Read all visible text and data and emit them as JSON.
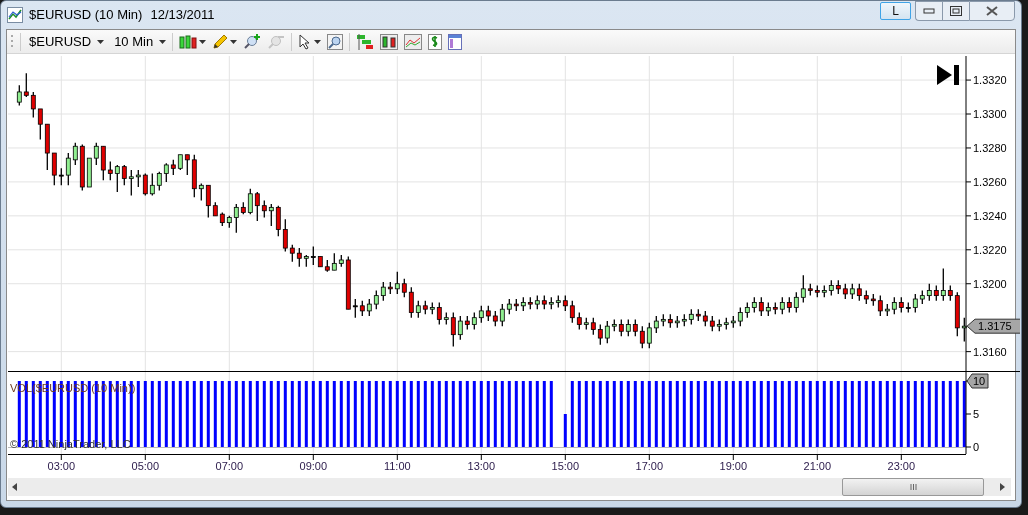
{
  "window": {
    "title": "$EURUSD (10 Min)",
    "date": "12/13/2011",
    "buttons": [
      {
        "label": "L"
      }
    ]
  },
  "toolbar": {
    "instrument": "$EURUSD",
    "interval": "10 Min"
  },
  "price_panel": {
    "last_price": "1.3175",
    "chart_data": {
      "type": "candlestick",
      "grid": true,
      "categories": [
        null,
        null,
        null,
        null,
        null,
        null,
        null,
        null,
        null,
        null,
        null,
        null,
        null,
        null,
        null,
        null,
        null,
        null,
        null,
        null,
        null,
        null,
        null,
        null,
        null,
        null,
        null,
        null,
        null,
        null,
        null,
        null,
        null,
        null,
        null,
        null,
        null,
        null,
        null,
        null,
        null,
        null,
        null,
        null,
        null,
        null,
        null,
        null,
        null,
        null,
        null,
        null,
        null,
        null,
        null,
        null,
        null,
        null,
        null,
        null,
        null,
        null,
        null,
        null,
        null,
        null,
        null,
        null,
        null,
        null,
        null,
        null,
        null,
        null,
        null,
        null,
        null,
        null,
        null,
        null,
        null,
        null,
        null,
        null,
        null,
        null,
        null,
        null,
        null,
        null,
        null,
        null,
        null,
        null,
        null,
        null,
        null,
        null,
        null,
        null,
        null,
        null,
        null,
        null,
        null,
        null,
        null,
        null,
        null,
        null,
        null,
        null,
        null,
        null,
        null,
        null,
        null,
        null,
        null,
        null,
        null,
        null,
        null,
        null,
        null,
        null,
        null,
        null,
        null,
        null,
        null,
        null,
        null,
        null,
        null,
        null
      ],
      "ylim": [
        1.3148,
        1.3333
      ],
      "yticks": [
        {
          "value": 1.316,
          "label": "1.3160"
        },
        {
          "value": 1.32,
          "label": "1.3200"
        },
        {
          "value": 1.322,
          "label": "1.3220"
        },
        {
          "value": 1.324,
          "label": "1.3240"
        },
        {
          "value": 1.326,
          "label": "1.3260"
        },
        {
          "value": 1.328,
          "label": "1.3280"
        },
        {
          "value": 1.33,
          "label": "1.3300"
        },
        {
          "value": 1.332,
          "label": "1.3320"
        }
      ],
      "ohlc": [
        [
          1.3307,
          1.3317,
          1.3305,
          1.3313
        ],
        [
          1.3313,
          1.3324,
          1.331,
          1.3311
        ],
        [
          1.3311,
          1.3313,
          1.3298,
          1.3303
        ],
        [
          1.3303,
          1.3303,
          1.3285,
          1.3294
        ],
        [
          1.3294,
          1.3294,
          1.3267,
          1.3277
        ],
        [
          1.3277,
          1.3277,
          1.3258,
          1.3264
        ],
        [
          1.3264,
          1.3268,
          1.3258,
          1.3264
        ],
        [
          1.3264,
          1.3277,
          1.3258,
          1.3274
        ],
        [
          1.3273,
          1.3283,
          1.327,
          1.3281
        ],
        [
          1.3281,
          1.3282,
          1.3255,
          1.3257
        ],
        [
          1.3257,
          1.3274,
          1.3257,
          1.3274
        ],
        [
          1.3274,
          1.3283,
          1.327,
          1.3281
        ],
        [
          1.3281,
          1.3281,
          1.3261,
          1.3267
        ],
        [
          1.3267,
          1.3272,
          1.3261,
          1.3265
        ],
        [
          1.3265,
          1.327,
          1.3254,
          1.3269
        ],
        [
          1.3269,
          1.327,
          1.3258,
          1.3262
        ],
        [
          1.3262,
          1.3267,
          1.3252,
          1.3263
        ],
        [
          1.3263,
          1.3267,
          1.3257,
          1.3264
        ],
        [
          1.3264,
          1.3265,
          1.3252,
          1.3253
        ],
        [
          1.3253,
          1.3265,
          1.3252,
          1.3258
        ],
        [
          1.3258,
          1.3266,
          1.3255,
          1.3265
        ],
        [
          1.3265,
          1.3271,
          1.326,
          1.327
        ],
        [
          1.327,
          1.3273,
          1.3264,
          1.3268
        ],
        [
          1.3268,
          1.3276,
          1.3267,
          1.3276
        ],
        [
          1.3276,
          1.3276,
          1.3264,
          1.3273
        ],
        [
          1.3273,
          1.3276,
          1.3251,
          1.3256
        ],
        [
          1.3256,
          1.3259,
          1.3249,
          1.3258
        ],
        [
          1.3258,
          1.3258,
          1.3239,
          1.3246
        ],
        [
          1.3246,
          1.3248,
          1.324,
          1.324
        ],
        [
          1.3241,
          1.3242,
          1.3234,
          1.3236
        ],
        [
          1.3236,
          1.324,
          1.3233,
          1.3239
        ],
        [
          1.3239,
          1.3247,
          1.323,
          1.3245
        ],
        [
          1.3245,
          1.3248,
          1.3241,
          1.3242
        ],
        [
          1.3242,
          1.3256,
          1.3241,
          1.3253
        ],
        [
          1.3253,
          1.3254,
          1.3237,
          1.3246
        ],
        [
          1.3246,
          1.3249,
          1.3239,
          1.3243
        ],
        [
          1.3243,
          1.3247,
          1.3234,
          1.3245
        ],
        [
          1.3245,
          1.3246,
          1.3228,
          1.3232
        ],
        [
          1.3232,
          1.3238,
          1.3219,
          1.3221
        ],
        [
          1.3221,
          1.3223,
          1.3213,
          1.3218
        ],
        [
          1.3218,
          1.3221,
          1.321,
          1.3215
        ],
        [
          1.3215,
          1.3217,
          1.321,
          1.3216
        ],
        [
          1.3216,
          1.3222,
          1.3211,
          1.3216
        ],
        [
          1.3216,
          1.3216,
          1.321,
          1.321
        ],
        [
          1.321,
          1.3214,
          1.3207,
          1.3208
        ],
        [
          1.3208,
          1.3218,
          1.3208,
          1.3212
        ],
        [
          1.3212,
          1.3217,
          1.321,
          1.3214
        ],
        [
          1.3214,
          1.3216,
          1.3185,
          1.3185
        ],
        [
          1.3187,
          1.3191,
          1.318,
          1.3187
        ],
        [
          1.3187,
          1.319,
          1.3181,
          1.3184
        ],
        [
          1.3184,
          1.3191,
          1.3181,
          1.3188
        ],
        [
          1.3188,
          1.3196,
          1.3185,
          1.3193
        ],
        [
          1.3193,
          1.3201,
          1.319,
          1.3198
        ],
        [
          1.3198,
          1.3201,
          1.3194,
          1.3197
        ],
        [
          1.3197,
          1.3207,
          1.3194,
          1.32
        ],
        [
          1.32,
          1.3203,
          1.3192,
          1.3195
        ],
        [
          1.3195,
          1.3198,
          1.318,
          1.3183
        ],
        [
          1.3183,
          1.319,
          1.318,
          1.3187
        ],
        [
          1.3187,
          1.319,
          1.3182,
          1.3185
        ],
        [
          1.3185,
          1.3189,
          1.3182,
          1.3186
        ],
        [
          1.3186,
          1.3189,
          1.3176,
          1.3179
        ],
        [
          1.3179,
          1.3183,
          1.3176,
          1.318
        ],
        [
          1.318,
          1.3183,
          1.3163,
          1.317
        ],
        [
          1.317,
          1.3181,
          1.3167,
          1.3178
        ],
        [
          1.3178,
          1.3181,
          1.3173,
          1.3176
        ],
        [
          1.3176,
          1.3183,
          1.3173,
          1.318
        ],
        [
          1.318,
          1.3187,
          1.3177,
          1.3184
        ],
        [
          1.3184,
          1.3187,
          1.3178,
          1.3181
        ],
        [
          1.3181,
          1.3184,
          1.3175,
          1.3178
        ],
        [
          1.3178,
          1.3188,
          1.3175,
          1.3185
        ],
        [
          1.3185,
          1.3191,
          1.3182,
          1.3188
        ],
        [
          1.3188,
          1.3191,
          1.3184,
          1.3187
        ],
        [
          1.3187,
          1.3192,
          1.3184,
          1.3189
        ],
        [
          1.3189,
          1.3192,
          1.3185,
          1.3188
        ],
        [
          1.3188,
          1.3193,
          1.3185,
          1.319
        ],
        [
          1.319,
          1.3193,
          1.3185,
          1.3188
        ],
        [
          1.3188,
          1.3192,
          1.3185,
          1.3189
        ],
        [
          1.3189,
          1.3193,
          1.3186,
          1.319
        ],
        [
          1.319,
          1.3193,
          1.3184,
          1.3187
        ],
        [
          1.3187,
          1.319,
          1.3177,
          1.318
        ],
        [
          1.318,
          1.3183,
          1.3173,
          1.3176
        ],
        [
          1.3176,
          1.318,
          1.3173,
          1.3177
        ],
        [
          1.3177,
          1.318,
          1.317,
          1.3173
        ],
        [
          1.3173,
          1.3176,
          1.3164,
          1.3168
        ],
        [
          1.3168,
          1.3178,
          1.3165,
          1.3175
        ],
        [
          1.3175,
          1.3179,
          1.3172,
          1.3176
        ],
        [
          1.3176,
          1.3179,
          1.3169,
          1.3172
        ],
        [
          1.3172,
          1.3179,
          1.3169,
          1.3176
        ],
        [
          1.3176,
          1.3179,
          1.3169,
          1.3172
        ],
        [
          1.3172,
          1.3175,
          1.3162,
          1.3165
        ],
        [
          1.3165,
          1.3177,
          1.3162,
          1.3174
        ],
        [
          1.3174,
          1.3181,
          1.3171,
          1.3178
        ],
        [
          1.3178,
          1.3182,
          1.3175,
          1.3179
        ],
        [
          1.3179,
          1.3182,
          1.3174,
          1.3177
        ],
        [
          1.3177,
          1.3181,
          1.3174,
          1.3178
        ],
        [
          1.3178,
          1.3182,
          1.3175,
          1.3179
        ],
        [
          1.3179,
          1.3185,
          1.3176,
          1.3182
        ],
        [
          1.3182,
          1.3185,
          1.3178,
          1.3181
        ],
        [
          1.3181,
          1.3184,
          1.3175,
          1.3178
        ],
        [
          1.3178,
          1.3181,
          1.3172,
          1.3175
        ],
        [
          1.3175,
          1.3179,
          1.3172,
          1.3176
        ],
        [
          1.3176,
          1.318,
          1.3173,
          1.3177
        ],
        [
          1.3177,
          1.3181,
          1.3174,
          1.3178
        ],
        [
          1.3178,
          1.3186,
          1.3175,
          1.3183
        ],
        [
          1.3183,
          1.3189,
          1.318,
          1.3186
        ],
        [
          1.3186,
          1.3192,
          1.3183,
          1.3189
        ],
        [
          1.3189,
          1.3192,
          1.3181,
          1.3184
        ],
        [
          1.3184,
          1.3189,
          1.3181,
          1.3186
        ],
        [
          1.3186,
          1.3189,
          1.3182,
          1.3185
        ],
        [
          1.3185,
          1.3192,
          1.3182,
          1.3189
        ],
        [
          1.3189,
          1.3192,
          1.3183,
          1.3186
        ],
        [
          1.3186,
          1.3195,
          1.3183,
          1.3192
        ],
        [
          1.3192,
          1.3205,
          1.3189,
          1.3197
        ],
        [
          1.3197,
          1.32,
          1.3193,
          1.3196
        ],
        [
          1.3196,
          1.3199,
          1.3192,
          1.3195
        ],
        [
          1.3195,
          1.3199,
          1.3192,
          1.3196
        ],
        [
          1.3196,
          1.3202,
          1.3193,
          1.3199
        ],
        [
          1.3199,
          1.3202,
          1.3194,
          1.3197
        ],
        [
          1.3197,
          1.32,
          1.3191,
          1.3194
        ],
        [
          1.3194,
          1.32,
          1.3191,
          1.3197
        ],
        [
          1.3197,
          1.32,
          1.319,
          1.3193
        ],
        [
          1.3193,
          1.3196,
          1.3188,
          1.3191
        ],
        [
          1.3191,
          1.3194,
          1.3187,
          1.319
        ],
        [
          1.319,
          1.3193,
          1.3181,
          1.3184
        ],
        [
          1.3184,
          1.3188,
          1.3181,
          1.3185
        ],
        [
          1.3185,
          1.3192,
          1.3182,
          1.3189
        ],
        [
          1.3189,
          1.3192,
          1.3183,
          1.3186
        ],
        [
          1.3186,
          1.3189,
          1.3183,
          1.3186
        ],
        [
          1.3186,
          1.3194,
          1.3183,
          1.3191
        ],
        [
          1.3191,
          1.3196,
          1.3188,
          1.3193
        ],
        [
          1.3193,
          1.32,
          1.319,
          1.3196
        ],
        [
          1.3196,
          1.3199,
          1.319,
          1.3193
        ],
        [
          1.3193,
          1.3209,
          1.319,
          1.3196
        ],
        [
          1.3196,
          1.3199,
          1.319,
          1.3193
        ],
        [
          1.3193,
          1.3195,
          1.3169,
          1.3174
        ],
        [
          1.3174,
          1.318,
          1.3166,
          1.3175
        ]
      ]
    }
  },
  "volume_panel": {
    "label": "VOL($EURUSD (10 Min))",
    "copyright": "© 2011 NinjaTrader, LLC",
    "last_value": "10",
    "chart_data": {
      "type": "bar",
      "grid": true,
      "ylim": [
        0,
        10
      ],
      "yticks": [
        0,
        5,
        10
      ],
      "categories": [
        null,
        null,
        null,
        null,
        null,
        null,
        "03:00",
        null,
        null,
        null,
        null,
        null,
        null,
        null,
        null,
        null,
        null,
        null,
        "05:00",
        null,
        null,
        null,
        null,
        null,
        null,
        null,
        null,
        null,
        null,
        null,
        "07:00",
        null,
        null,
        null,
        null,
        null,
        null,
        null,
        null,
        null,
        null,
        null,
        "09:00",
        null,
        null,
        null,
        null,
        null,
        null,
        null,
        null,
        null,
        null,
        null,
        "11:00",
        null,
        null,
        null,
        null,
        null,
        null,
        null,
        null,
        null,
        null,
        null,
        "13:00",
        null,
        null,
        null,
        null,
        null,
        null,
        null,
        null,
        null,
        null,
        null,
        "15:00",
        null,
        null,
        null,
        null,
        null,
        null,
        null,
        null,
        null,
        null,
        null,
        "17:00",
        null,
        null,
        null,
        null,
        null,
        null,
        null,
        null,
        null,
        null,
        null,
        "19:00",
        null,
        null,
        null,
        null,
        null,
        null,
        null,
        null,
        null,
        null,
        null,
        "21:00",
        null,
        null,
        null,
        null,
        null,
        null,
        null,
        null,
        null,
        null,
        null,
        "23:00",
        null,
        null,
        null,
        null,
        null,
        null,
        null,
        null,
        null
      ],
      "series": [
        {
          "color": "#0000ff",
          "values": [
            10,
            10,
            10,
            10,
            10,
            10,
            10,
            10,
            10,
            10,
            10,
            10,
            10,
            10,
            10,
            10,
            10,
            10,
            10,
            10,
            10,
            10,
            10,
            10,
            10,
            10,
            10,
            10,
            10,
            10,
            10,
            10,
            10,
            10,
            10,
            10,
            10,
            10,
            10,
            10,
            10,
            10,
            10,
            10,
            10,
            10,
            10,
            10,
            10,
            10,
            10,
            10,
            10,
            10,
            10,
            10,
            10,
            10,
            10,
            10,
            10,
            10,
            10,
            10,
            10,
            10,
            10,
            10,
            10,
            10,
            10,
            10,
            10,
            10,
            10,
            10,
            10,
            null,
            5,
            10,
            10,
            10,
            10,
            10,
            10,
            10,
            10,
            10,
            10,
            10,
            10,
            10,
            10,
            10,
            10,
            10,
            10,
            10,
            10,
            10,
            10,
            10,
            10,
            10,
            10,
            10,
            10,
            10,
            10,
            10,
            10,
            10,
            10,
            10,
            10,
            10,
            10,
            10,
            10,
            10,
            10,
            10,
            10,
            10,
            10,
            10,
            10,
            10,
            10,
            10,
            10,
            10,
            10,
            10,
            10,
            10
          ]
        }
      ]
    }
  }
}
